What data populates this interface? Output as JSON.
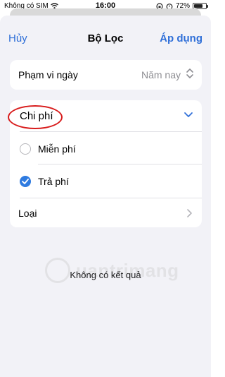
{
  "status_bar": {
    "carrier": "Không có SIM",
    "time": "16:00",
    "battery_percent": "72%",
    "battery_level": 0.72
  },
  "nav": {
    "cancel_label": "Hủy",
    "title": "Bộ Lọc",
    "apply_label": "Áp dụng"
  },
  "date_range": {
    "label": "Phạm vi ngày",
    "value": "Năm nay"
  },
  "fee": {
    "label": "Chi phí",
    "options": [
      {
        "label": "Miễn phí",
        "selected": false
      },
      {
        "label": "Trả phí",
        "selected": true
      }
    ]
  },
  "type": {
    "label": "Loại"
  },
  "watermark": {
    "text": "uantrimang"
  },
  "empty_state": {
    "text": "Không có kết quả"
  },
  "colors": {
    "accent": "#2f6fd8",
    "highlight_circle": "#d81b1b"
  }
}
